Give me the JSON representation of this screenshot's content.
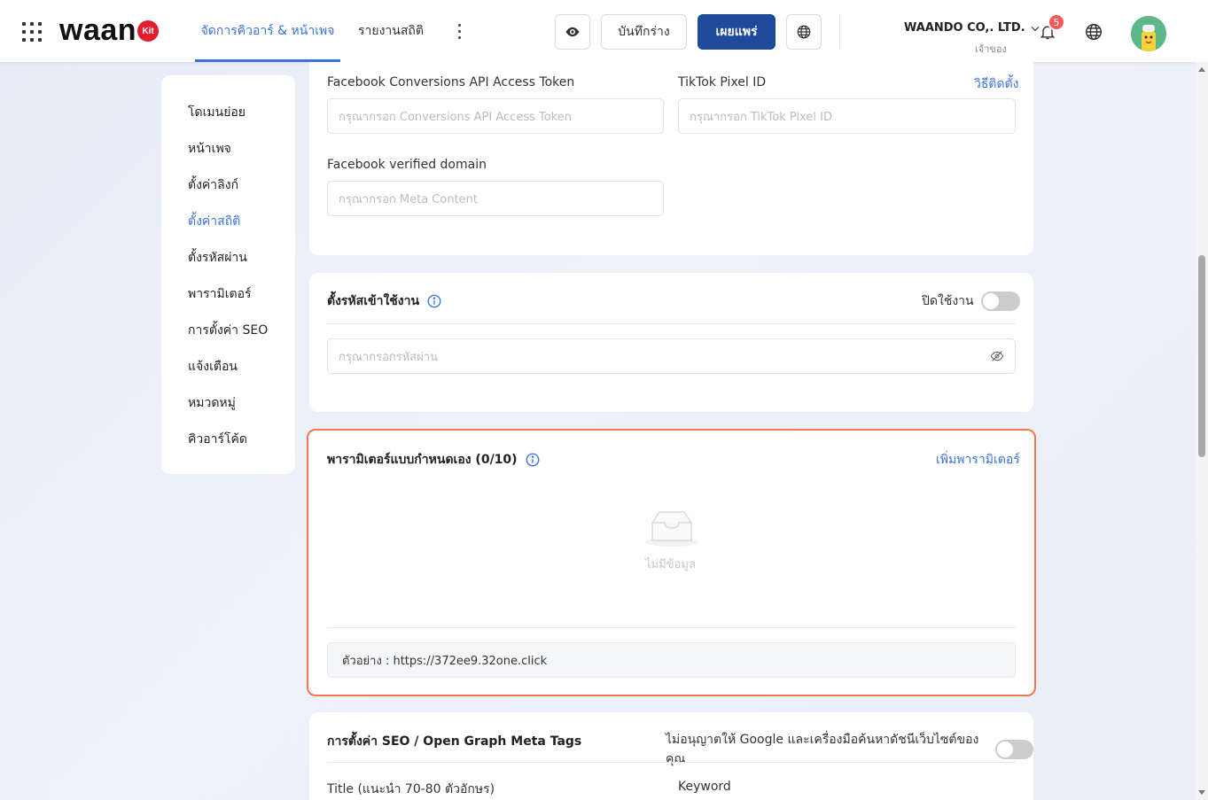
{
  "header": {
    "logo_text": "waan",
    "logo_badge": "Kit",
    "tabs": [
      {
        "label": "จัดการคิวอาร์ & หน้าเพจ",
        "active": true
      },
      {
        "label": "รายงานสถิติ",
        "active": false
      }
    ],
    "draft_label": "บันทึกร่าง",
    "publish_label": "เผยแพร่",
    "company": "WAANDO CO,. LTD.",
    "role": "เจ้าของ",
    "notification_count": "5",
    "accent_color": "#3b72e0",
    "publish_color": "#1f4a9c"
  },
  "sidebar": {
    "items": [
      {
        "label": "โดเมนย่อย"
      },
      {
        "label": "หน้าเพจ"
      },
      {
        "label": "ตั้งค่าลิงก์"
      },
      {
        "label": "ตั้งค่าสถิติ",
        "active": true
      },
      {
        "label": "ตั้งรหัสผ่าน"
      },
      {
        "label": "พารามิเตอร์"
      },
      {
        "label": "การตั้งค่า SEO"
      },
      {
        "label": "แจ้งเตือน"
      },
      {
        "label": "หมวดหมู่"
      },
      {
        "label": "คิวอาร์โค้ด"
      }
    ]
  },
  "tracking": {
    "fb_capi_label": "Facebook Conversions API Access Token",
    "fb_capi_placeholder": "กรุณากรอก Conversions API Access Token",
    "tiktok_label": "TikTok Pixel ID",
    "tiktok_howto": "วิธีติดตั้ง",
    "tiktok_placeholder": "กรุณากรอก TikTok Pixel ID",
    "fb_domain_label": "Facebook verified domain",
    "fb_domain_placeholder": "กรุณากรอก Meta Content"
  },
  "password": {
    "title": "ตั้งรหัสเข้าใช้งาน",
    "toggle_label": "ปิดใช้งาน",
    "placeholder": "กรุณากรอกรหัสผ่าน"
  },
  "params": {
    "title": "พารามิเตอร์แบบกำหนดเอง (0/10)",
    "add_label": "เพิ่มพารามิเตอร์",
    "empty_text": "ไม่มีข้อมูล",
    "example": "ตัวอย่าง : https://372ee9.32one.click",
    "highlight_color": "#f07a4a"
  },
  "seo": {
    "title": "การตั้งค่า SEO / Open Graph Meta Tags",
    "toggle_label": "ไม่อนุญาตให้ Google และเครื่องมือค้นหาดัชนีเว็บไซต์ของคุณ",
    "title_label": "Title (แนะนำ 70-80 ตัวอักษร)",
    "keyword_label": "Keyword"
  }
}
